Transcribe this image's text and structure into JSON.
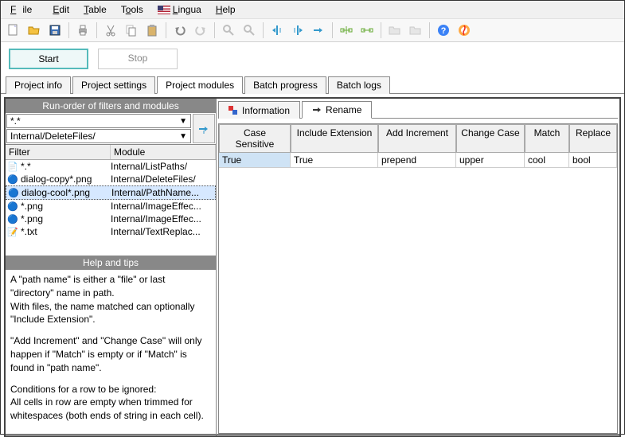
{
  "menu": {
    "file": "File",
    "edit": "Edit",
    "table": "Table",
    "tools": "Tools",
    "lingua": "Lingua",
    "help": "Help"
  },
  "buttons": {
    "start": "Start",
    "stop": "Stop"
  },
  "tabs": [
    "Project info",
    "Project settings",
    "Project modules",
    "Batch progress",
    "Batch logs"
  ],
  "active_tab": 2,
  "left": {
    "title": "Run-order of filters and modules",
    "combo1": "*.*",
    "combo2": "Internal/DeleteFiles/",
    "col_filter": "Filter",
    "col_module": "Module",
    "rows": [
      {
        "icon": "doc",
        "filter": "*.*",
        "module": "Internal/ListPaths/"
      },
      {
        "icon": "img",
        "filter": "dialog-copy*.png",
        "module": "Internal/DeleteFiles/"
      },
      {
        "icon": "img",
        "filter": "dialog-cool*.png",
        "module": "Internal/PathName...",
        "sel": true
      },
      {
        "icon": "img",
        "filter": "*.png",
        "module": "Internal/ImageEffec..."
      },
      {
        "icon": "img",
        "filter": "*.png",
        "module": "Internal/ImageEffec..."
      },
      {
        "icon": "txt",
        "filter": "*.txt",
        "module": "Internal/TextReplac..."
      }
    ],
    "help_title": "Help and tips",
    "help_p1": "A \"path name\" is either a \"file\" or last \"directory\" name in path.",
    "help_p2": "With files, the name matched can optionally \"Include Extension\".",
    "help_p3": "\"Add Increment\" and \"Change Case\" will only happen if \"Match\" is empty or if \"Match\" is found in \"path name\".",
    "help_p4": "Conditions for a row to be ignored:",
    "help_p5": "All cells in row are empty when trimmed for whitespaces (both ends of string in each cell)."
  },
  "right": {
    "tab_info": "Information",
    "tab_rename": "Rename",
    "headers": {
      "cs": "Case Sensitive",
      "ie": "Include Extension",
      "ai": "Add Increment",
      "cc": "Change Case",
      "m": "Match",
      "r": "Replace"
    },
    "row": {
      "cs": "True",
      "ie": "True",
      "ai": "prepend",
      "cc": "upper",
      "m": "cool",
      "r": "bool"
    }
  }
}
